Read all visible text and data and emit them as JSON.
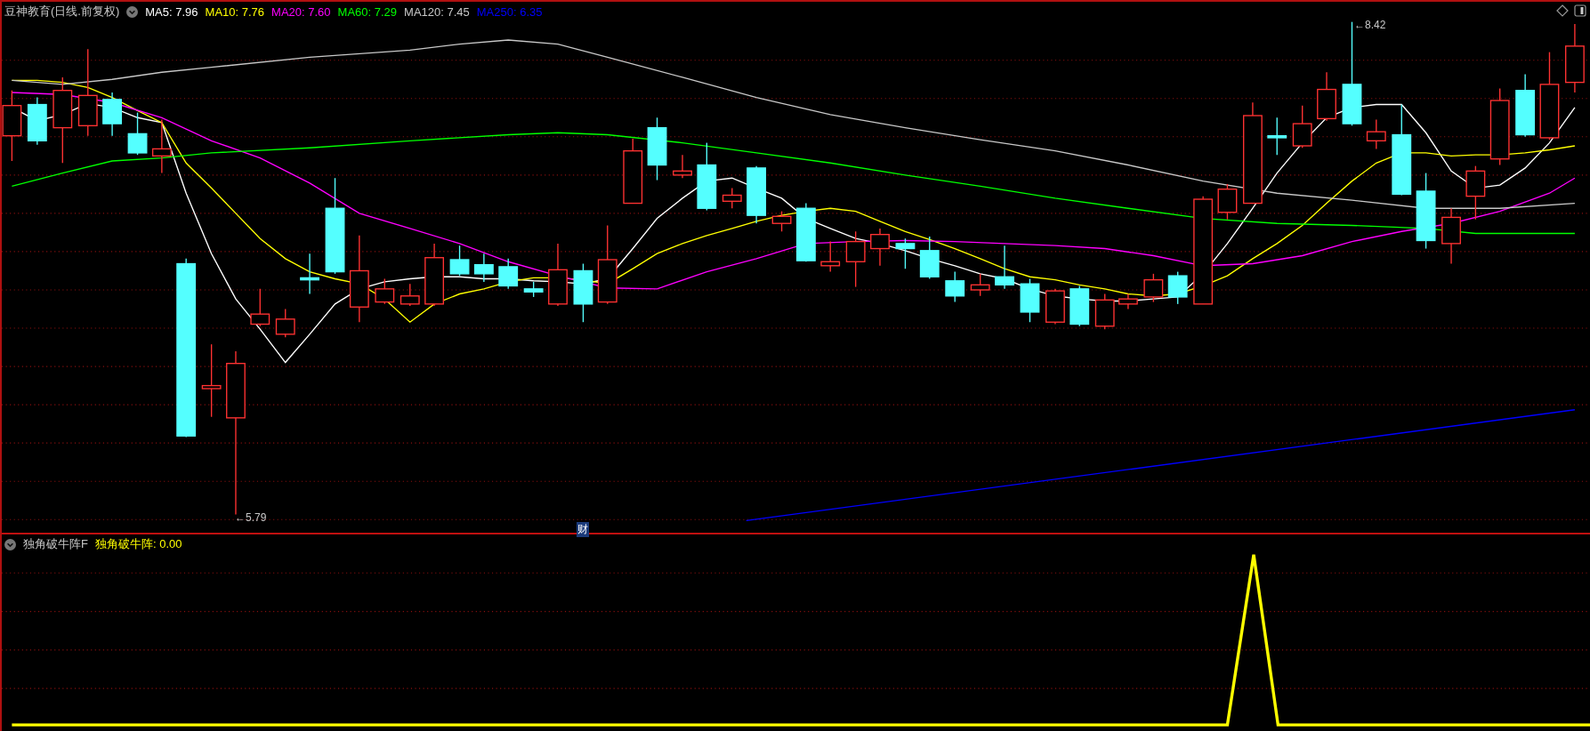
{
  "main_panel": {
    "title": "豆神教育(日线.前复权)",
    "indicators": [
      {
        "label": "MA5: 7.96",
        "color": "#ffffff"
      },
      {
        "label": "MA10: 7.76",
        "color": "#ffff00"
      },
      {
        "label": "MA20: 7.60",
        "color": "#ff00ff"
      },
      {
        "label": "MA60: 7.29",
        "color": "#00ff00"
      },
      {
        "label": "MA120: 7.45",
        "color": "#c8c8c8"
      },
      {
        "label": "MA250: 6.35",
        "color": "#0000ff"
      }
    ],
    "high_label": "←8.42",
    "low_label": "←5.79",
    "event_badge": "财"
  },
  "sub_panel": {
    "title": "独角破牛阵F",
    "indicators": [
      {
        "label": "独角破牛阵: 0.00",
        "color": "#ffff00"
      }
    ]
  }
}
